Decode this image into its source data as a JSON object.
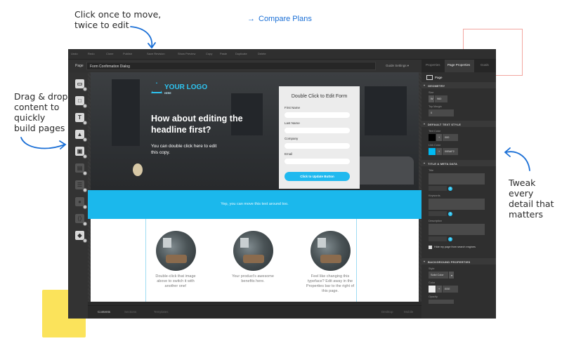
{
  "annotations": {
    "move_edit": [
      "Click once to move,",
      "twice to edit"
    ],
    "drag_drop": [
      "Drag & drop",
      "content to",
      "quickly",
      "build pages"
    ],
    "tweak": [
      "Tweak every",
      "detail that",
      "matters"
    ],
    "compare_plans": "Compare Plans"
  },
  "toolbar": {
    "items": [
      "Undo",
      "Redo",
      "Clone",
      "Publish",
      "Save Revision",
      "Show Preview",
      "Copy",
      "Paste",
      "Duplicate",
      "Delete"
    ]
  },
  "pagebar": {
    "page_label": "Page",
    "selector_value": "Form Confirmation Dialog",
    "guide_settings": "Guide Settings"
  },
  "hero": {
    "logo_text": "YOUR LOGO",
    "logo_sub": "HERE",
    "headline": "How about editing the headline first?",
    "copy": "You can double click here to edit this copy."
  },
  "form": {
    "title": "Double Click to Edit Form",
    "fields": [
      "First Name",
      "Last Name",
      "Company",
      "Email"
    ],
    "button": "Click to Update Button"
  },
  "band_text": "Yep, you can move this text around too.",
  "features": [
    "Double-click that image above to switch it with another one!",
    "Your product's awesome benefits here.",
    "Feel like changing this typeface? Edit away in the Properties bar to the right of this page."
  ],
  "right_panel": {
    "tabs": [
      "Properties",
      "Page Properties",
      "Goals"
    ],
    "page_label": "Page",
    "sections": [
      "GEOMETRY",
      "DEFAULT TEXT STYLE",
      "TITLE & META DATA",
      "BACKGROUND PROPERTIES"
    ],
    "size_label": "Size",
    "width_value": "960",
    "top_margin_label": "Top Margin",
    "top_margin_value": "0",
    "text_color_label": "Text Color",
    "text_color_value": "000",
    "link_color_label": "Link Color",
    "link_color_value": "00BAF2",
    "title_label": "Title",
    "keywords_label": "Keywords",
    "description_label": "Description",
    "hide_search": "Hide my page from search engines",
    "style_label": "Style",
    "style_value": "Solid Color",
    "color_label": "Color",
    "color_value": "EEE",
    "opacity_label": "Opacity"
  },
  "bottom_bar": [
    "Contents",
    "Sections",
    "Templates",
    "Desktop",
    "Mobile"
  ],
  "colors": {
    "accent": "#1BB8EC",
    "link_color": "#00BAF2",
    "annotation_blue": "#1A6FD6"
  },
  "tools": [
    "section-icon",
    "box-icon",
    "text-icon",
    "image-icon",
    "form-icon",
    "button-icon",
    "list-icon",
    "video-icon",
    "code-icon",
    "social-icon"
  ]
}
